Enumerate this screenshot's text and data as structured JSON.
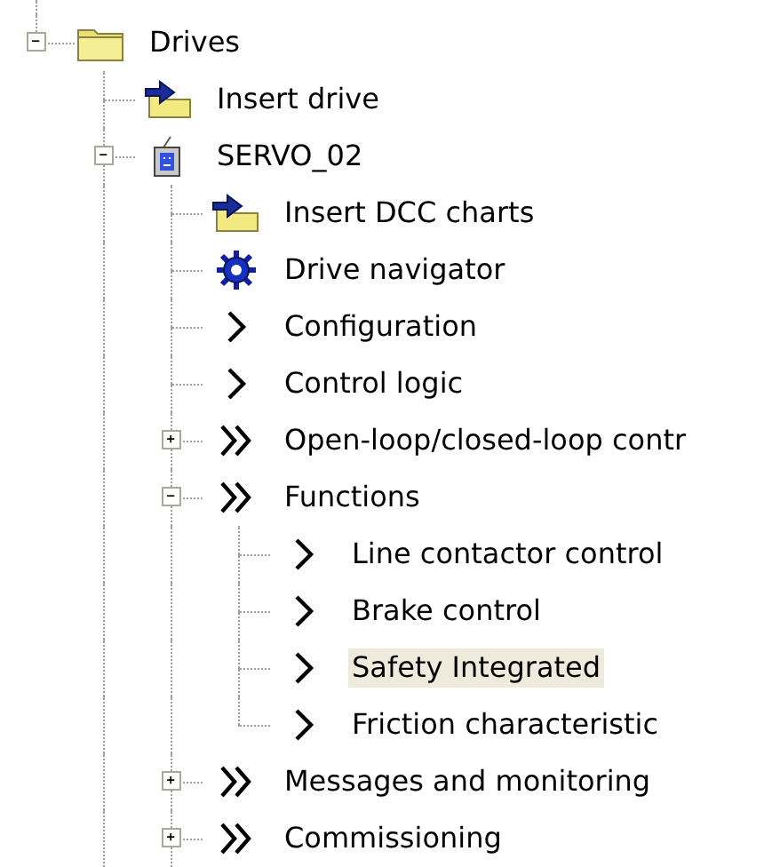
{
  "tree": [
    {
      "label": "Drives",
      "kind": "folder",
      "expanded": true,
      "selected": false,
      "more_below": false,
      "children": [
        {
          "label": "Insert drive",
          "kind": "insert",
          "selected": false,
          "more_below": true
        },
        {
          "label": "SERVO_02",
          "kind": "device",
          "expanded": true,
          "selected": false,
          "more_below": true,
          "children": [
            {
              "label": "Insert DCC charts",
              "kind": "insert",
              "selected": false,
              "more_below": true
            },
            {
              "label": "Drive navigator",
              "kind": "navigator",
              "selected": false,
              "more_below": true
            },
            {
              "label": "Configuration",
              "kind": "chevron",
              "selected": false,
              "more_below": true
            },
            {
              "label": "Control logic",
              "kind": "chevron",
              "selected": false,
              "more_below": true
            },
            {
              "label": "Open-loop/closed-loop contr",
              "kind": "double-chevron",
              "expanded": false,
              "selected": false,
              "more_below": true
            },
            {
              "label": "Functions",
              "kind": "double-chevron",
              "expanded": true,
              "selected": false,
              "more_below": true,
              "children": [
                {
                  "label": "Line contactor control",
                  "kind": "chevron",
                  "selected": false,
                  "more_below": true
                },
                {
                  "label": "Brake control",
                  "kind": "chevron",
                  "selected": false,
                  "more_below": true
                },
                {
                  "label": "Safety Integrated",
                  "kind": "chevron",
                  "selected": true,
                  "more_below": true
                },
                {
                  "label": "Friction characteristic",
                  "kind": "chevron",
                  "selected": false,
                  "more_below": false
                }
              ]
            },
            {
              "label": "Messages and monitoring",
              "kind": "double-chevron",
              "expanded": false,
              "selected": false,
              "more_below": true
            },
            {
              "label": "Commissioning",
              "kind": "double-chevron",
              "expanded": false,
              "selected": false,
              "more_below": true
            }
          ]
        }
      ]
    }
  ]
}
